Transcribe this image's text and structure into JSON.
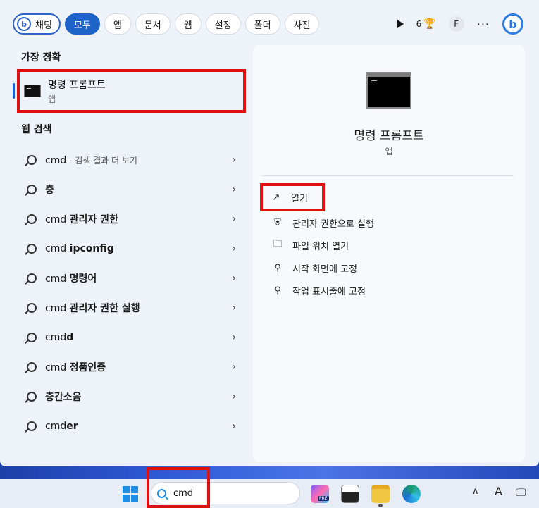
{
  "filters": {
    "chat_label": "채팅",
    "chat_badge": "b",
    "tabs": [
      {
        "label": "모두",
        "active": true
      },
      {
        "label": "앱",
        "active": false
      },
      {
        "label": "문서",
        "active": false
      },
      {
        "label": "웹",
        "active": false
      },
      {
        "label": "설정",
        "active": false
      },
      {
        "label": "폴더",
        "active": false
      },
      {
        "label": "사진",
        "active": false
      }
    ]
  },
  "toolbar": {
    "points": "6",
    "trophy": "🏆",
    "avatar_initial": "F",
    "more": "···",
    "bing_letter": "b"
  },
  "best_match": {
    "section_title": "가장 정확",
    "name": "명령 프롬프트",
    "type": "앱"
  },
  "web_search": {
    "section_title": "웹 검색",
    "items": [
      {
        "prefix": "cmd",
        "bold": "",
        "sub": " - 검색 결과 더 보기"
      },
      {
        "prefix": "",
        "bold": "층",
        "sub": ""
      },
      {
        "prefix": "cmd ",
        "bold": "관리자 권한",
        "sub": ""
      },
      {
        "prefix": "cmd ",
        "bold": "ipconfig",
        "sub": ""
      },
      {
        "prefix": "cmd ",
        "bold": "명령어",
        "sub": ""
      },
      {
        "prefix": "cmd ",
        "bold": "관리자 권한 실행",
        "sub": ""
      },
      {
        "prefix": "cmd",
        "bold": "d",
        "sub": ""
      },
      {
        "prefix": "cmd ",
        "bold": "정품인증",
        "sub": ""
      },
      {
        "prefix": "",
        "bold": "층간소음",
        "sub": ""
      },
      {
        "prefix": "cmd",
        "bold": "er",
        "sub": ""
      }
    ]
  },
  "detail": {
    "title": "명령 프롬프트",
    "subtitle": "앱",
    "actions": [
      {
        "label": "열기",
        "icon": "↗"
      },
      {
        "label": "관리자 권한으로 실행",
        "icon": "⛨"
      },
      {
        "label": "파일 위치 열기",
        "icon": "🗀"
      },
      {
        "label": "시작 화면에 고정",
        "icon": "⚲"
      },
      {
        "label": "작업 표시줄에 고정",
        "icon": "⚲"
      }
    ]
  },
  "taskbar": {
    "search_value": "cmd",
    "pre_badge": "PRE",
    "tray_chevron": "∧",
    "tray_ime": "A",
    "tray_icon": "🖵"
  }
}
